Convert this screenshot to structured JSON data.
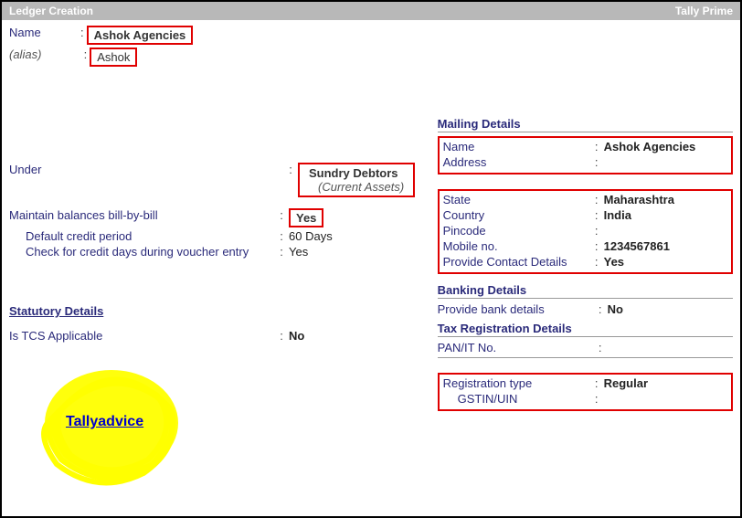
{
  "title_left": "Ledger Creation",
  "title_right": "Tally Prime",
  "name_label": "Name",
  "name_value": "Ashok Agencies",
  "alias_label": "(alias)",
  "alias_value": "Ashok",
  "under_label": "Under",
  "under_value": "Sundry Debtors",
  "under_group": "(Current Assets)",
  "mbb_label": "Maintain balances bill-by-bill",
  "mbb_value": "Yes",
  "credit_period_label": "Default credit period",
  "credit_period_value": "60 Days",
  "credit_check_label": "Check for credit days during voucher entry",
  "credit_check_value": "Yes",
  "statutory_heading": "Statutory Details",
  "tcs_label": "Is TCS Applicable",
  "tcs_value": "No",
  "watermark": "Tallyadvice",
  "mailing_heading": "Mailing Details",
  "mail_name_label": "Name",
  "mail_name_value": "Ashok Agencies",
  "address_label": "Address",
  "address_value": "",
  "state_label": "State",
  "state_value": "Maharashtra",
  "country_label": "Country",
  "country_value": "India",
  "pincode_label": "Pincode",
  "pincode_value": "",
  "mobile_label": "Mobile no.",
  "mobile_value": "1234567861",
  "contact_label": "Provide Contact Details",
  "contact_value": "Yes",
  "banking_heading": "Banking Details",
  "bank_label": "Provide bank details",
  "bank_value": "No",
  "tax_heading": "Tax Registration Details",
  "pan_label": "PAN/IT No.",
  "pan_value": "",
  "regtype_label": "Registration type",
  "regtype_value": "Regular",
  "gstin_label": "GSTIN/UIN",
  "gstin_value": ""
}
